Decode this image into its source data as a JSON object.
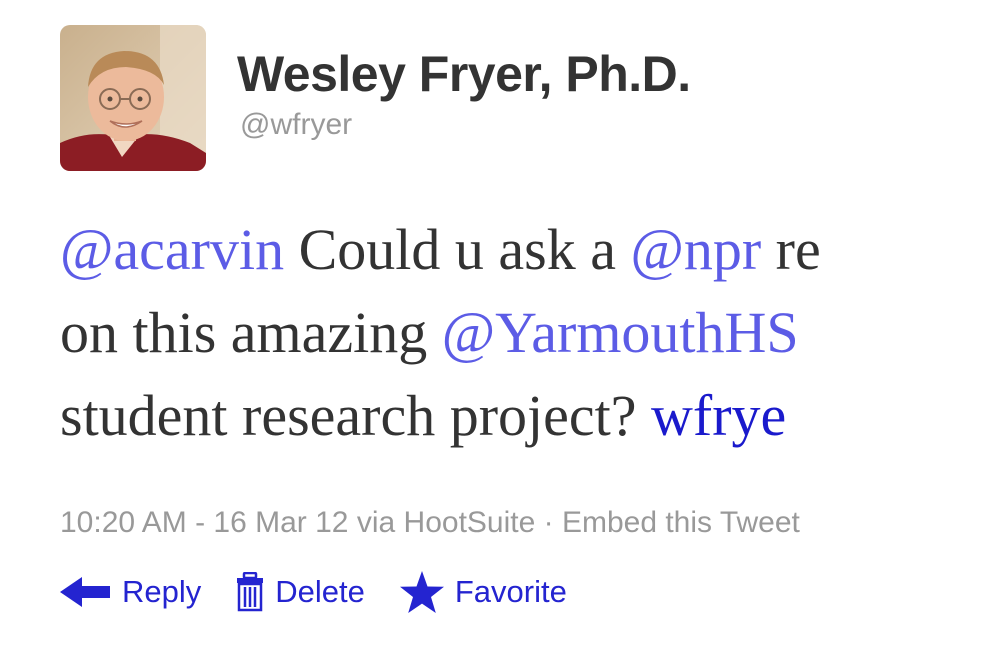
{
  "user": {
    "display_name": "Wesley Fryer, Ph.D.",
    "screen_name": "@wfryer",
    "avatar": "profile-photo"
  },
  "tweet": {
    "lines": [
      [
        {
          "text": "@acarvin",
          "type": "mention"
        },
        {
          "text": " Could u ask a ",
          "type": "text"
        },
        {
          "text": "@npr",
          "type": "mention"
        },
        {
          "text": " re",
          "type": "text"
        }
      ],
      [
        {
          "text": "on this amazing ",
          "type": "text"
        },
        {
          "text": "@YarmouthHS",
          "type": "mention"
        }
      ],
      [
        {
          "text": "student research project? ",
          "type": "text"
        },
        {
          "text": "wfrye",
          "type": "link"
        }
      ]
    ]
  },
  "meta": {
    "timestamp": "10:20 AM - 16 Mar 12",
    "via_prefix": " via ",
    "source": "HootSuite",
    "separator": " · ",
    "embed": "Embed this Tweet"
  },
  "actions": {
    "reply": {
      "label": "Reply",
      "icon": "reply-arrow-icon"
    },
    "delete": {
      "label": "Delete",
      "icon": "trash-icon"
    },
    "favorite": {
      "label": "Favorite",
      "icon": "star-icon"
    }
  },
  "colors": {
    "mention": "#5c5ce6",
    "link": "#1a1acc",
    "text": "#333333",
    "muted": "#999999",
    "action": "#2424d0"
  }
}
